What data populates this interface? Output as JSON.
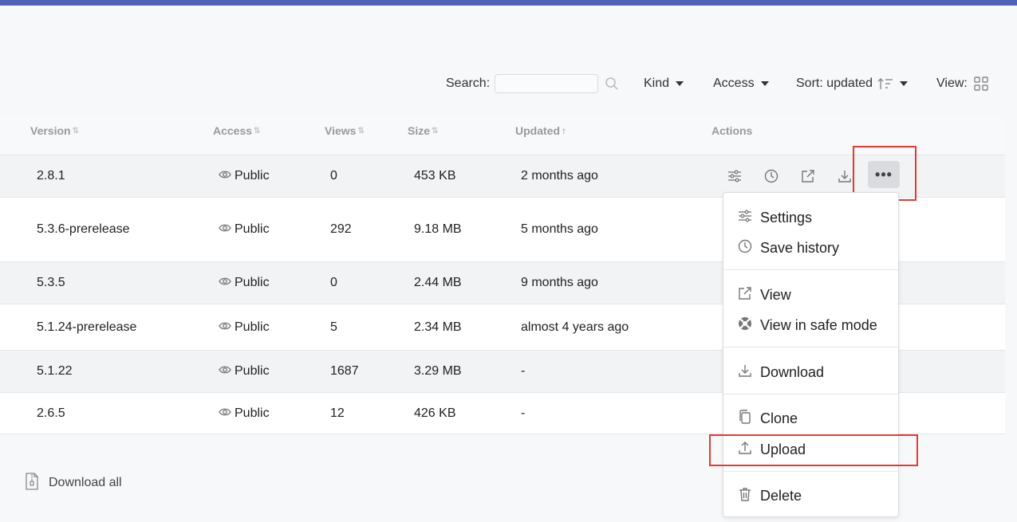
{
  "toolbar": {
    "search_label": "Search:",
    "search_value": "",
    "kind_label": "Kind",
    "access_label": "Access",
    "sort_label": "Sort: updated",
    "view_label": "View:"
  },
  "table": {
    "columns": [
      "Version",
      "Access",
      "Views",
      "Size",
      "Updated",
      "Actions"
    ],
    "rows": [
      {
        "version": "2.8.1",
        "access": "Public",
        "views": "0",
        "size": "453 KB",
        "updated": "2 months ago"
      },
      {
        "version": "5.3.6-prerelease",
        "access": "Public",
        "views": "292",
        "size": "9.18 MB",
        "updated": "5 months ago"
      },
      {
        "version": "5.3.5",
        "access": "Public",
        "views": "0",
        "size": "2.44 MB",
        "updated": "9 months ago"
      },
      {
        "version": "5.1.24-prerelease",
        "access": "Public",
        "views": "5",
        "size": "2.34 MB",
        "updated": "almost 4 years ago"
      },
      {
        "version": "5.1.22",
        "access": "Public",
        "views": "1687",
        "size": "3.29 MB",
        "updated": "-"
      },
      {
        "version": "2.6.5",
        "access": "Public",
        "views": "12",
        "size": "426 KB",
        "updated": "-"
      }
    ]
  },
  "more_button_label": "•••",
  "menu": {
    "settings": "Settings",
    "save_history": "Save history",
    "view": "View",
    "view_safe_mode": "View in safe mode",
    "download": "Download",
    "clone": "Clone",
    "upload": "Upload",
    "delete": "Delete"
  },
  "footer": {
    "download_all": "Download all"
  },
  "colors": {
    "topbar": "#4f62b8",
    "highlight": "#e53935"
  }
}
